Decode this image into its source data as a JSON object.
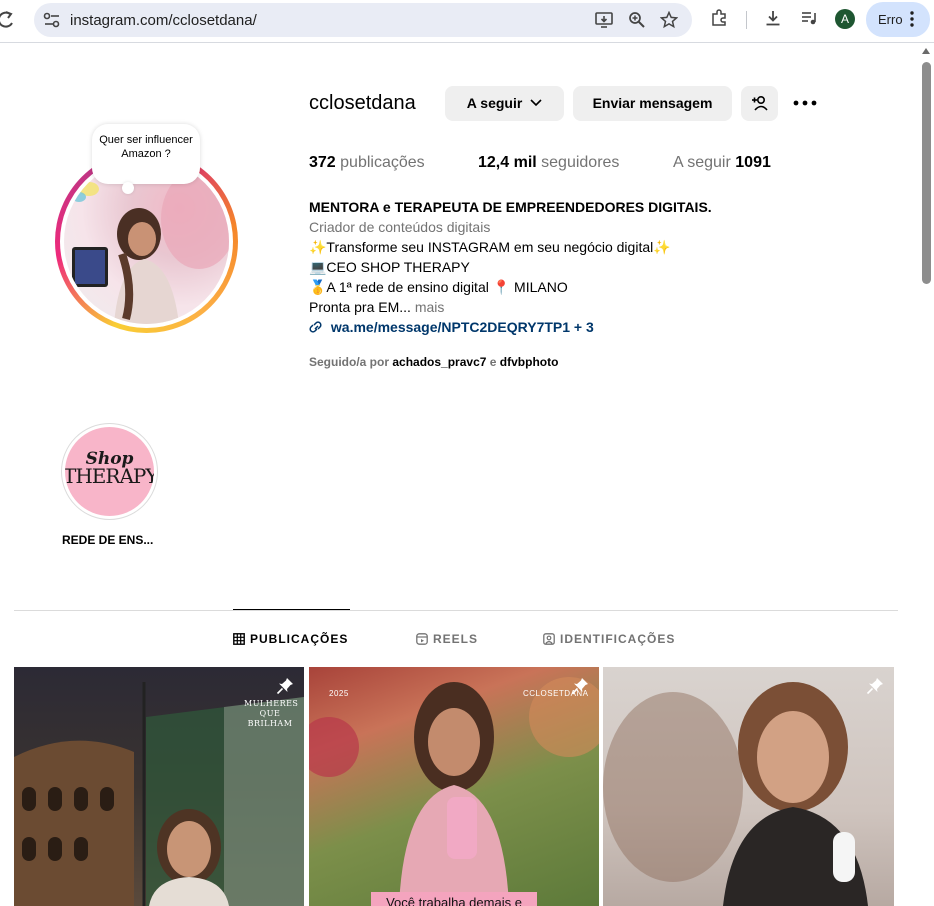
{
  "browser": {
    "url": "instagram.com/cclosetdana/",
    "profile_initial": "A",
    "error_label": "Erro"
  },
  "profile": {
    "username": "cclosetdana",
    "note": "Quer ser influencer Amazon ?",
    "buttons": {
      "follow": "A seguir",
      "message": "Enviar mensagem"
    },
    "stats": {
      "posts_count": "372",
      "posts_label": "publicações",
      "followers_count": "12,4 mil",
      "followers_label": "seguidores",
      "following_label": "A seguir",
      "following_count": "1091"
    },
    "bio": {
      "title": "MENTORA e TERAPEUTA DE EMPREENDEDORES DIGITAIS.",
      "category": "Criador de conteúdos digitais",
      "line1": "✨Transforme seu INSTAGRAM em seu negócio digital✨",
      "line2": "💻CEO SHOP THERAPY",
      "line3": "🥇A 1ª rede de ensino digital 📍 MILANO",
      "line4": "Pronta pra EM...",
      "more": "mais",
      "link": "wa.me/message/NPTC2DEQRY7TP1 + 3"
    },
    "followed_by": {
      "prefix": "Seguido/a por",
      "user1": "achados_pravc7",
      "conj": "e",
      "user2": "dfvbphoto"
    }
  },
  "highlights": [
    {
      "label": "REDE DE ENS...",
      "cover_line1": "Shop",
      "cover_line2": "THERAPY"
    }
  ],
  "tabs": [
    {
      "label": "PUBLICAÇÕES",
      "icon": "grid-icon",
      "active": true
    },
    {
      "label": "REELS",
      "icon": "reels-icon",
      "active": false
    },
    {
      "label": "IDENTIFICAÇÕES",
      "icon": "tagged-icon",
      "active": false
    }
  ],
  "posts": [
    {
      "overlay": "MULHERES QUE BRILHAM",
      "pinned": true
    },
    {
      "overlay_left": "2025",
      "overlay_right": "CCLOSETDANA",
      "banner": "Você trabalha demais e",
      "pinned": true
    },
    {
      "pinned": true
    }
  ]
}
